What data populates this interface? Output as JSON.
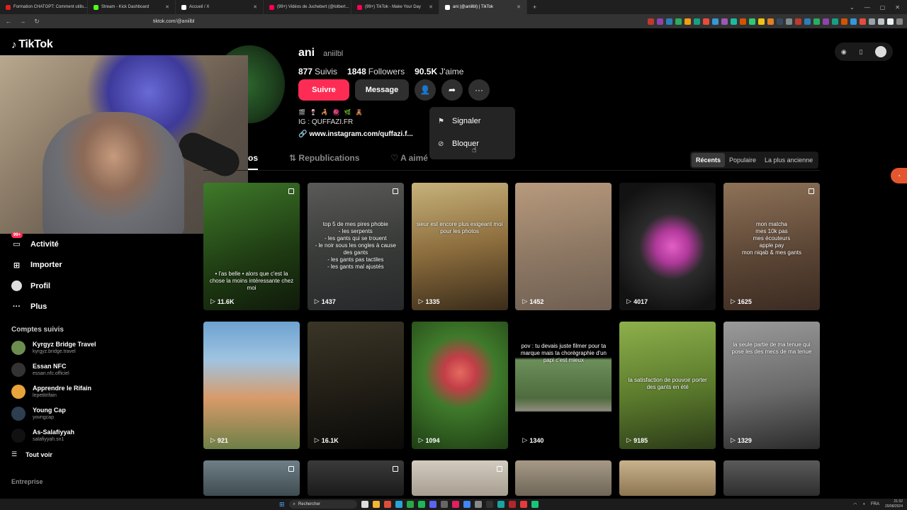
{
  "browser": {
    "tabs": [
      {
        "label": "Formation CHATGPT: Comment utilis...",
        "color": "#e02020",
        "active": false
      },
      {
        "label": "Stream - Kick Dashboard",
        "color": "#53fc18",
        "active": false
      },
      {
        "label": "Accueil / X",
        "color": "#ffffff",
        "active": false
      },
      {
        "label": "(99+) Vidéos de Juchebert (@lolbert...",
        "color": "#ff0050",
        "active": false
      },
      {
        "label": "(99+) TikTok - Make Your Day",
        "color": "#ff0050",
        "active": false
      },
      {
        "label": "ani (@aniilbl) | TikTok",
        "color": "#ffffff",
        "active": true
      }
    ],
    "new_tab": "+",
    "url": "tiktok.com/@aniilbl"
  },
  "logo": {
    "text": "TikTok",
    "icon": "tiktok-note-icon"
  },
  "profile": {
    "name": "ani",
    "handle": "aniilbl",
    "stats": [
      {
        "value": "877",
        "label": "Suivis"
      },
      {
        "value": "1848",
        "label": "Followers"
      },
      {
        "value": "90.5K",
        "label": "J'aime"
      }
    ],
    "follow_label": "Suivre",
    "message_label": "Message",
    "bio_emojis": "🎬 🍷 🦂 🧶 🌿 🧸",
    "bio_line": "IG : QUFFAZI.FR",
    "link": "www.instagram.com/quffazi.f..."
  },
  "menu": {
    "items": [
      {
        "label": "Signaler",
        "icon": "flag-icon"
      },
      {
        "label": "Bloquer",
        "icon": "block-icon"
      }
    ]
  },
  "content_tabs": [
    {
      "label": "os",
      "active": true
    },
    {
      "label": "Republications",
      "active": false,
      "icon": "repost-icon"
    },
    {
      "label": "A aimé",
      "active": false,
      "icon": "lock-heart-icon"
    }
  ],
  "sort": [
    "Récents",
    "Populaire",
    "La plus ancienne"
  ],
  "sidebar": {
    "badge": "99+",
    "items": [
      {
        "label": "Activité",
        "icon": "inbox-icon"
      },
      {
        "label": "Importer",
        "icon": "plus-square-icon"
      },
      {
        "label": "Profil",
        "icon": "avatar"
      },
      {
        "label": "Plus",
        "icon": "more-icon"
      }
    ],
    "following_heading": "Comptes suivis",
    "accounts": [
      {
        "name": "Kyrgyz Bridge Travel",
        "handle": "kyrgyz.bridge.travel",
        "color": "#6b8e4e"
      },
      {
        "name": "Essan NFC",
        "handle": "essan.nfc.officiel",
        "color": "#333333"
      },
      {
        "name": "Apprendre le Rifain",
        "handle": "lepetitrifain",
        "color": "#e8a33a"
      },
      {
        "name": "Young Cap",
        "handle": "yovngcap",
        "color": "#2c3e50"
      },
      {
        "name": "As-Salafiyyah",
        "handle": "salafiyyah.sn1",
        "color": "#111111"
      }
    ],
    "see_all": "Tout voir",
    "enterprise": "Entreprise"
  },
  "videos": [
    {
      "views": "11.6K",
      "bg": "linear-gradient(160deg,#3f7a2a,#1e3a12 60%,#0f1a0a)",
      "caption": "• l'as belle • alors que c'est la chose la moins intéressante chez moi",
      "multi": true
    },
    {
      "views": "1437",
      "bg": "linear-gradient(170deg,#5a5a58,#3a3c3a 50%,#26282a)",
      "caption": "top 5 de mes pires phobie\n- les serpents\n- les gants qui se trouent\n- le noir sous les ongles à cause des gants\n- les gants pas tactiles\n- les gants mal ajustés",
      "multi": true
    },
    {
      "views": "1335",
      "bg": "linear-gradient(170deg,#c7b27b,#8d6e3e 50%,#3a2c1a)",
      "caption": "sieur est encore plus exigeant moi pour les photos",
      "multi": false
    },
    {
      "views": "1452",
      "bg": "linear-gradient(170deg,#b89a7d,#8c7763 55%,#6f5f52)",
      "caption": "",
      "multi": false
    },
    {
      "views": "4017",
      "bg": "radial-gradient(circle at 55% 50%,#e35fc7 0%,#b0399a 20%,#2b2b2b 40%,#121212 80%)",
      "caption": "",
      "multi": false
    },
    {
      "views": "1625",
      "bg": "linear-gradient(170deg,#8e7258,#5c4635 55%,#3b2b22)",
      "caption": "mon matcha\nmes 10k pas\nmes écouteurs\napple pay\nmon niqab & mes gants",
      "multi": true
    },
    {
      "views": "921",
      "bg": "linear-gradient(180deg,#6ea2d0 0%,#9fc4e1 30%,#d89b6a 60%,#6e7f47 100%)",
      "caption": "",
      "multi": false
    },
    {
      "views": "16.1K",
      "bg": "linear-gradient(170deg,#3a3526,#1e1b14 60%,#0a0a08)",
      "caption": "",
      "multi": false
    },
    {
      "views": "1094",
      "bg": "radial-gradient(circle at 50% 40%,#e56a5f 0%,#c23e48 18%,#3f7a2b 40%,#1f3d14 100%)",
      "caption": "",
      "multi": false
    },
    {
      "views": "1340",
      "bg": "linear-gradient(180deg,#000 0%,#000 28%,#6c8f5a 30%,#4e6b3e 60%,#8e8c7c 70%,#000 71%,#000 100%)",
      "caption": "pov : tu devais juste filmer pour ta marque mais ta chorégraphie d'un papi c'est mieux",
      "multi": false
    },
    {
      "views": "9185",
      "bg": "linear-gradient(170deg,#8db04b,#5b7a2c 55%,#2b3a18)",
      "caption": "la satisfaction de pouvoir porter des gants en été",
      "multi": false
    },
    {
      "views": "1329",
      "bg": "linear-gradient(170deg,#9a9a9a,#6a6a6a 55%,#2b2b2b)",
      "caption": "la seule partie de ma tenue qui pose les des mecs de ma tenue",
      "multi": false
    },
    {
      "views": "",
      "bg": "linear-gradient(180deg,#6f7f87,#3f4b50)",
      "caption": "",
      "multi": true
    },
    {
      "views": "",
      "bg": "linear-gradient(180deg,#3a3a3a,#1a1a1a)",
      "caption": "",
      "multi": true
    },
    {
      "views": "",
      "bg": "linear-gradient(180deg,#d2cbbf,#a79e90)",
      "caption": "",
      "multi": true
    },
    {
      "views": "",
      "bg": "linear-gradient(180deg,#a69a86,#6f6658)",
      "caption": "",
      "multi": false
    },
    {
      "views": "",
      "bg": "linear-gradient(180deg,#c9b28d,#8c7551)",
      "caption": "",
      "multi": false
    },
    {
      "views": "",
      "bg": "linear-gradient(180deg,#5a5a5a,#2e2e2e)",
      "caption": "",
      "multi": false
    }
  ],
  "taskbar": {
    "search": "Rechercher",
    "lang": "FRA",
    "time": "21:32",
    "date": "20/08/2024"
  }
}
